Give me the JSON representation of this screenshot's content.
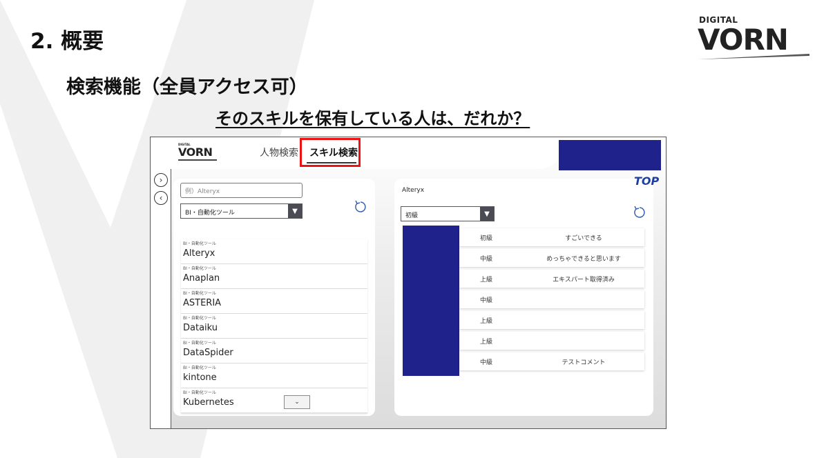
{
  "slide": {
    "title": "2. 概要",
    "subtitle": "検索機能（全員アクセス可）",
    "question": "そのスキルを保有している人は、だれか？"
  },
  "brand": {
    "small": "DIGITAL",
    "big": "VORN"
  },
  "app": {
    "logo_small": "DIGITAL",
    "logo_big": "VORN",
    "tabs": [
      {
        "label": "人物検索",
        "active": false
      },
      {
        "label": "スキル検索",
        "active": true
      }
    ],
    "top_link": "TOP",
    "left_panel": {
      "search_placeholder": "例）Alteryx",
      "category_select": "BI・自動化ツール",
      "skills": [
        {
          "category": "BI・自動化ツール",
          "name": "Alteryx"
        },
        {
          "category": "BI・自動化ツール",
          "name": "Anaplan"
        },
        {
          "category": "BI・自動化ツール",
          "name": "ASTERIA"
        },
        {
          "category": "BI・自動化ツール",
          "name": "Dataiku"
        },
        {
          "category": "BI・自動化ツール",
          "name": "DataSpider"
        },
        {
          "category": "BI・自動化ツール",
          "name": "kintone"
        },
        {
          "category": "BI・自動化ツール",
          "name": "Kubernetes"
        }
      ]
    },
    "right_panel": {
      "selected_skill": "Alteryx",
      "level_select": "初級",
      "results": [
        {
          "level": "初級",
          "comment": "すごいできる"
        },
        {
          "level": "中級",
          "comment": "めっちゃできると思います"
        },
        {
          "level": "上級",
          "comment": "エキスパート取得済み"
        },
        {
          "level": "中級",
          "comment": ""
        },
        {
          "level": "上級",
          "comment": ""
        },
        {
          "level": "上級",
          "comment": ""
        },
        {
          "level": "中級",
          "comment": "テストコメント"
        }
      ]
    }
  },
  "colors": {
    "navy": "#1e228a",
    "highlight": "#e11111",
    "top_link": "#1f3fa0"
  }
}
